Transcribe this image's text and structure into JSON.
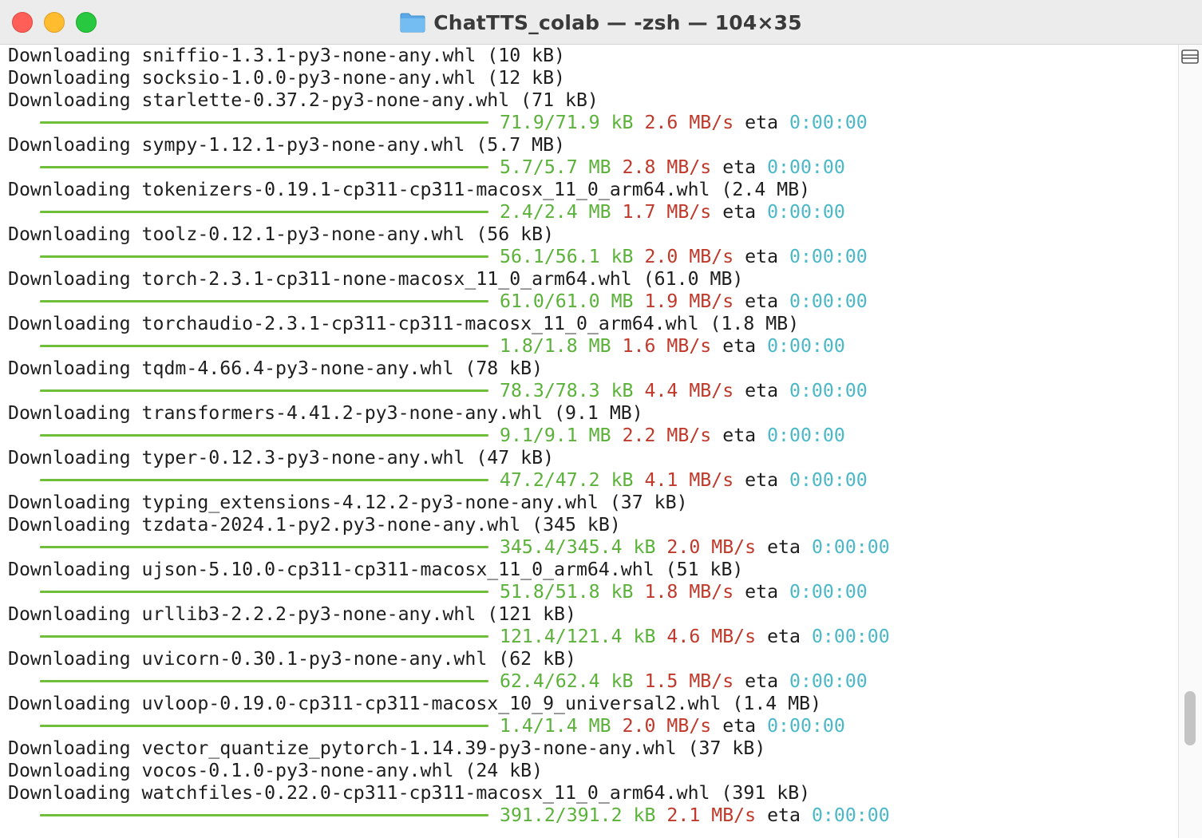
{
  "window": {
    "title": "ChatTTS_colab — -zsh — 104×35",
    "icon": "folder-icon"
  },
  "colors": {
    "progress_bar": "#6fbe3c",
    "size": "#5bb23a",
    "rate": "#c0392b",
    "eta_time": "#4ab8c9"
  },
  "terminal": {
    "lines": [
      {
        "kind": "text",
        "text": "Downloading sniffio-1.3.1-py3-none-any.whl (10 kB)"
      },
      {
        "kind": "text",
        "text": "Downloading socksio-1.0.0-py3-none-any.whl (12 kB)"
      },
      {
        "kind": "text",
        "text": "Downloading starlette-0.37.2-py3-none-any.whl (71 kB)"
      },
      {
        "kind": "progress",
        "size": "71.9/71.9 kB",
        "rate": "2.6 MB/s",
        "eta_label": "eta",
        "eta": "0:00:00"
      },
      {
        "kind": "text",
        "text": "Downloading sympy-1.12.1-py3-none-any.whl (5.7 MB)"
      },
      {
        "kind": "progress",
        "size": "5.7/5.7 MB",
        "rate": "2.8 MB/s",
        "eta_label": "eta",
        "eta": "0:00:00"
      },
      {
        "kind": "text",
        "text": "Downloading tokenizers-0.19.1-cp311-cp311-macosx_11_0_arm64.whl (2.4 MB)"
      },
      {
        "kind": "progress",
        "size": "2.4/2.4 MB",
        "rate": "1.7 MB/s",
        "eta_label": "eta",
        "eta": "0:00:00"
      },
      {
        "kind": "text",
        "text": "Downloading toolz-0.12.1-py3-none-any.whl (56 kB)"
      },
      {
        "kind": "progress",
        "size": "56.1/56.1 kB",
        "rate": "2.0 MB/s",
        "eta_label": "eta",
        "eta": "0:00:00"
      },
      {
        "kind": "text",
        "text": "Downloading torch-2.3.1-cp311-none-macosx_11_0_arm64.whl (61.0 MB)"
      },
      {
        "kind": "progress",
        "size": "61.0/61.0 MB",
        "rate": "1.9 MB/s",
        "eta_label": "eta",
        "eta": "0:00:00"
      },
      {
        "kind": "text",
        "text": "Downloading torchaudio-2.3.1-cp311-cp311-macosx_11_0_arm64.whl (1.8 MB)"
      },
      {
        "kind": "progress",
        "size": "1.8/1.8 MB",
        "rate": "1.6 MB/s",
        "eta_label": "eta",
        "eta": "0:00:00"
      },
      {
        "kind": "text",
        "text": "Downloading tqdm-4.66.4-py3-none-any.whl (78 kB)"
      },
      {
        "kind": "progress",
        "size": "78.3/78.3 kB",
        "rate": "4.4 MB/s",
        "eta_label": "eta",
        "eta": "0:00:00"
      },
      {
        "kind": "text",
        "text": "Downloading transformers-4.41.2-py3-none-any.whl (9.1 MB)"
      },
      {
        "kind": "progress",
        "size": "9.1/9.1 MB",
        "rate": "2.2 MB/s",
        "eta_label": "eta",
        "eta": "0:00:00"
      },
      {
        "kind": "text",
        "text": "Downloading typer-0.12.3-py3-none-any.whl (47 kB)"
      },
      {
        "kind": "progress",
        "size": "47.2/47.2 kB",
        "rate": "4.1 MB/s",
        "eta_label": "eta",
        "eta": "0:00:00"
      },
      {
        "kind": "text",
        "text": "Downloading typing_extensions-4.12.2-py3-none-any.whl (37 kB)"
      },
      {
        "kind": "text",
        "text": "Downloading tzdata-2024.1-py2.py3-none-any.whl (345 kB)"
      },
      {
        "kind": "progress",
        "size": "345.4/345.4 kB",
        "rate": "2.0 MB/s",
        "eta_label": "eta",
        "eta": "0:00:00"
      },
      {
        "kind": "text",
        "text": "Downloading ujson-5.10.0-cp311-cp311-macosx_11_0_arm64.whl (51 kB)"
      },
      {
        "kind": "progress",
        "size": "51.8/51.8 kB",
        "rate": "1.8 MB/s",
        "eta_label": "eta",
        "eta": "0:00:00"
      },
      {
        "kind": "text",
        "text": "Downloading urllib3-2.2.2-py3-none-any.whl (121 kB)"
      },
      {
        "kind": "progress",
        "size": "121.4/121.4 kB",
        "rate": "4.6 MB/s",
        "eta_label": "eta",
        "eta": "0:00:00"
      },
      {
        "kind": "text",
        "text": "Downloading uvicorn-0.30.1-py3-none-any.whl (62 kB)"
      },
      {
        "kind": "progress",
        "size": "62.4/62.4 kB",
        "rate": "1.5 MB/s",
        "eta_label": "eta",
        "eta": "0:00:00"
      },
      {
        "kind": "text",
        "text": "Downloading uvloop-0.19.0-cp311-cp311-macosx_10_9_universal2.whl (1.4 MB)"
      },
      {
        "kind": "progress",
        "size": "1.4/1.4 MB",
        "rate": "2.0 MB/s",
        "eta_label": "eta",
        "eta": "0:00:00"
      },
      {
        "kind": "text",
        "text": "Downloading vector_quantize_pytorch-1.14.39-py3-none-any.whl (37 kB)"
      },
      {
        "kind": "text",
        "text": "Downloading vocos-0.1.0-py3-none-any.whl (24 kB)"
      },
      {
        "kind": "text",
        "text": "Downloading watchfiles-0.22.0-cp311-cp311-macosx_11_0_arm64.whl (391 kB)"
      },
      {
        "kind": "progress",
        "size": "391.2/391.2 kB",
        "rate": "2.1 MB/s",
        "eta_label": "eta",
        "eta": "0:00:00"
      }
    ]
  }
}
